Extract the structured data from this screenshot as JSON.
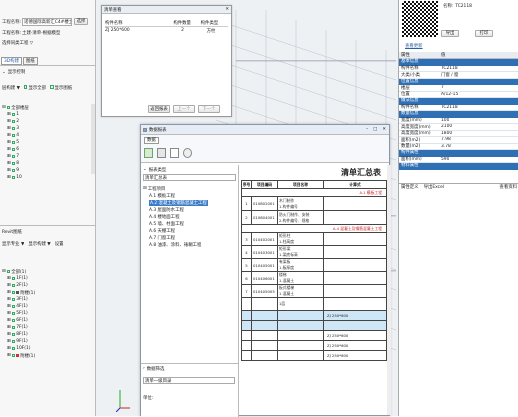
{
  "left_panel": {
    "fields": [
      {
        "label": "工程名称:",
        "value": "诺德国际高新汇C4#楼土建"
      },
      {
        "label": "工程名称:",
        "value": "土建-清单-根据模型"
      },
      {
        "label": "",
        "value": "选择同类工程 ▽"
      }
    ],
    "select_button": "选择",
    "tabs": [
      "3D构建",
      "图纸"
    ],
    "section_title": "显示控制",
    "toolbar": [
      "层构建 ▼",
      "显示全部",
      "显示图纸"
    ],
    "tree_top": {
      "root": "全部楼层",
      "items": [
        "1",
        "2",
        "3",
        "4",
        "5",
        "6",
        "7",
        "8",
        "9",
        "10"
      ]
    },
    "bottom_title": "Revit图纸",
    "bottom_toolbar": [
      "显示专业 ▼",
      "显示构建 ▼",
      "设置"
    ],
    "tree_bottom": {
      "root": "全部(1)",
      "items": [
        "1F(1)",
        "2F(1)",
        "附楼(1)",
        "3F(1)",
        "4F(1)",
        "5F(1)",
        "6F(1)",
        "7F(1)",
        "8F(1)",
        "9F(1)",
        "10F(1)",
        "附楼(1)"
      ]
    }
  },
  "top_dialog": {
    "title": "清单查看",
    "columns": [
      "构件名称",
      "构件数量",
      "构件类型"
    ],
    "rows": [
      [
        "ZJ 250*600",
        "2",
        "方柱"
      ]
    ],
    "buttons": [
      "返回报表",
      "上一个",
      "下一个"
    ]
  },
  "report_window": {
    "title": "数据报表",
    "toolbar_label": "数据",
    "toolbar_icons": [
      "export-icon",
      "print-icon",
      "page-icon",
      "settings-icon"
    ],
    "sections": [
      "报表类型",
      "数据筛选"
    ],
    "select_label": "清单汇总表",
    "tree_root": "工程项目",
    "tree_items": [
      "A.1 模板工程",
      "A.2 混凝土及钢筋混凝土工程",
      "A.3 屋面防水工程",
      "A.4 楼地面工程",
      "A.5 墙、柱面工程",
      "A.6 天棚工程",
      "A.7 门窗工程",
      "A.8 油漆、涂料、裱糊工程"
    ],
    "filter_select": "清单一级目录",
    "filter_label": "单位:"
  },
  "table": {
    "title": "清单汇总表",
    "columns": [
      "序号",
      "项目编码",
      "项目名称",
      "计算式"
    ],
    "group1": "A.1 模板工程",
    "rows1": [
      {
        "no": "1",
        "code": "010802001",
        "name": "木门制作\n1.构件编号"
      },
      {
        "no": "2",
        "code": "010804001",
        "name": "防火门制作、安装\n2.构件编号、规格"
      }
    ],
    "group2": "A.4 混凝土及钢筋混凝土工程",
    "rows2": [
      {
        "no": "3",
        "code": "010402001",
        "name": "矩形柱\n1.柱高度"
      },
      {
        "no": "4",
        "code": "010403001",
        "name": "矩形梁\n1.梁底标高"
      },
      {
        "no": "5",
        "code": "010405001",
        "name": "有梁板\n1.板厚度"
      },
      {
        "no": "6",
        "code": "010406001",
        "name": "楼梯\n1.混凝土"
      },
      {
        "no": "7",
        "code": "010405005",
        "name": "板式楼梯\n1.混凝土"
      },
      {
        "no": "",
        "code": "",
        "name": "1层"
      }
    ],
    "calc_rows": [
      "ZJ 250*600",
      "",
      "ZJ 250*600",
      "ZJ 250*600",
      "ZJ 250*600"
    ]
  },
  "right_panel": {
    "name_label": "名称:",
    "name_value": "TC2118",
    "buttons": [
      "导出",
      "打印"
    ],
    "link": "查看更新",
    "columns": [
      "属性",
      "值"
    ],
    "props": [
      {
        "sect": "基本信息"
      },
      {
        "k": "构件名称",
        "v": "TC2118"
      },
      {
        "k": "大类/小类",
        "v": "门窗 / 窗"
      },
      {
        "sect": "位置信息"
      },
      {
        "k": "楼层",
        "v": "7"
      },
      {
        "k": "位置",
        "v": "A/12-15"
      },
      {
        "sect": "做法信息"
      },
      {
        "k": "构件名称",
        "v": "TC2118"
      },
      {
        "sect": "数量信息"
      },
      {
        "k": "宽度(mm)",
        "v": "100"
      },
      {
        "k": "高度宽度(mm)",
        "v": "2100"
      },
      {
        "k": "高度宽度(mm)",
        "v": "1800"
      },
      {
        "k": "面积(m2)",
        "v": "7.98"
      },
      {
        "k": "数量(m2)",
        "v": "3.78"
      },
      {
        "sect": "构件属性"
      },
      {
        "k": "面积(mm)",
        "v": "590"
      },
      {
        "sect": "材料属性"
      }
    ],
    "tabs": [
      "属性定义",
      "导出Excel",
      "查看资料"
    ]
  }
}
